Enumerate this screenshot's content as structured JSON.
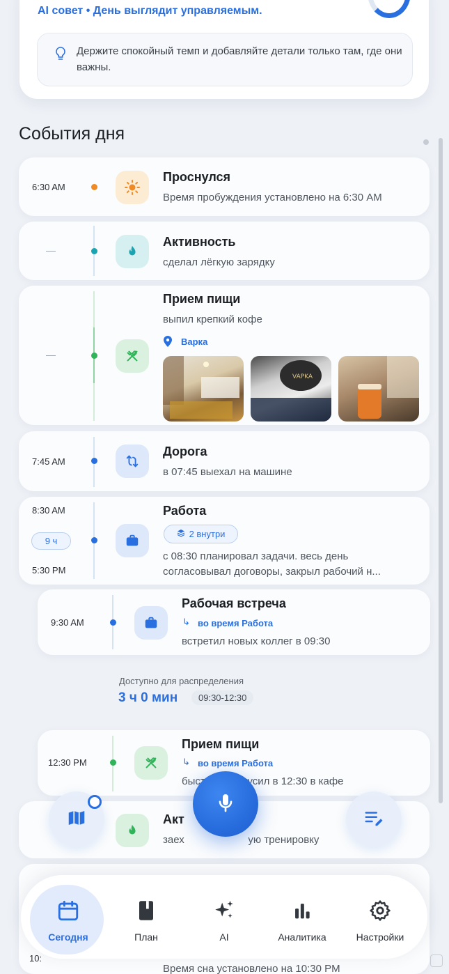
{
  "header": {
    "ai_line": "AI совет • День выглядит управляемым.",
    "tip": "Держите спокойный темп и добавляйте детали только там, где они важны.",
    "section_title": "События дня"
  },
  "events": [
    {
      "time": "6:30 AM",
      "title": "Проснулся",
      "subtitle": "Время пробуждения установлено на 6:30 AM",
      "icon": "sun-icon",
      "color": "#f08a24"
    },
    {
      "time": "—",
      "title": "Активность",
      "subtitle": "сделал лёгкую зарядку",
      "icon": "flame-icon",
      "color": "#1aa3b0"
    },
    {
      "time": "—",
      "title": "Прием пищи",
      "subtitle": "выпил крепкий кофе",
      "location": "Варка",
      "icon": "utensils-icon",
      "color": "#2fb45a"
    },
    {
      "time": "7:45 AM",
      "title": "Дорога",
      "subtitle": "в 07:45 выехал на машине",
      "icon": "route-icon",
      "color": "#2a6fe0"
    },
    {
      "time_start": "8:30 AM",
      "duration": "9 ч",
      "time_end": "5:30 PM",
      "title": "Работа",
      "badge": "2 внутри",
      "subtitle_1": "с 08:30 планировал задачи. весь день",
      "subtitle_2": "согласовывал договоры, закрыл рабочий н...",
      "icon": "briefcase-icon",
      "color": "#2a6fe0"
    },
    {
      "time": "9:30 AM",
      "title": "Рабочая встреча",
      "parent": "во время Работа",
      "subtitle": "встретил новых коллег в 09:30",
      "icon": "briefcase-icon",
      "color": "#2a6fe0"
    },
    {
      "time": "12:30 PM",
      "title": "Прием пищи",
      "parent": "во время Работа",
      "subtitle": "быстро перекусил в 12:30 в кафе",
      "icon": "utensils-icon",
      "color": "#2fb45a"
    },
    {
      "title": "Акт",
      "subtitle": "заех                      ую тренировку",
      "icon": "flame-icon"
    },
    {
      "time": "10:",
      "subtitle": "Время сна установлено на 10:30 PM"
    }
  ],
  "available": {
    "label": "Доступно для распределения",
    "value": "3 ч 0 мин",
    "range": "09:30-12:30"
  },
  "nav": {
    "items": [
      {
        "label": "Сегодня",
        "icon": "calendar-icon",
        "active": true
      },
      {
        "label": "План",
        "icon": "book-icon"
      },
      {
        "label": "AI",
        "icon": "sparkle-icon"
      },
      {
        "label": "Аналитика",
        "icon": "bar-chart-icon"
      },
      {
        "label": "Настройки",
        "icon": "gear-icon"
      }
    ]
  },
  "colors": {
    "accent": "#2a6fe0",
    "orange": "#f08a24",
    "teal": "#1aa3b0",
    "green": "#2fb45a"
  }
}
